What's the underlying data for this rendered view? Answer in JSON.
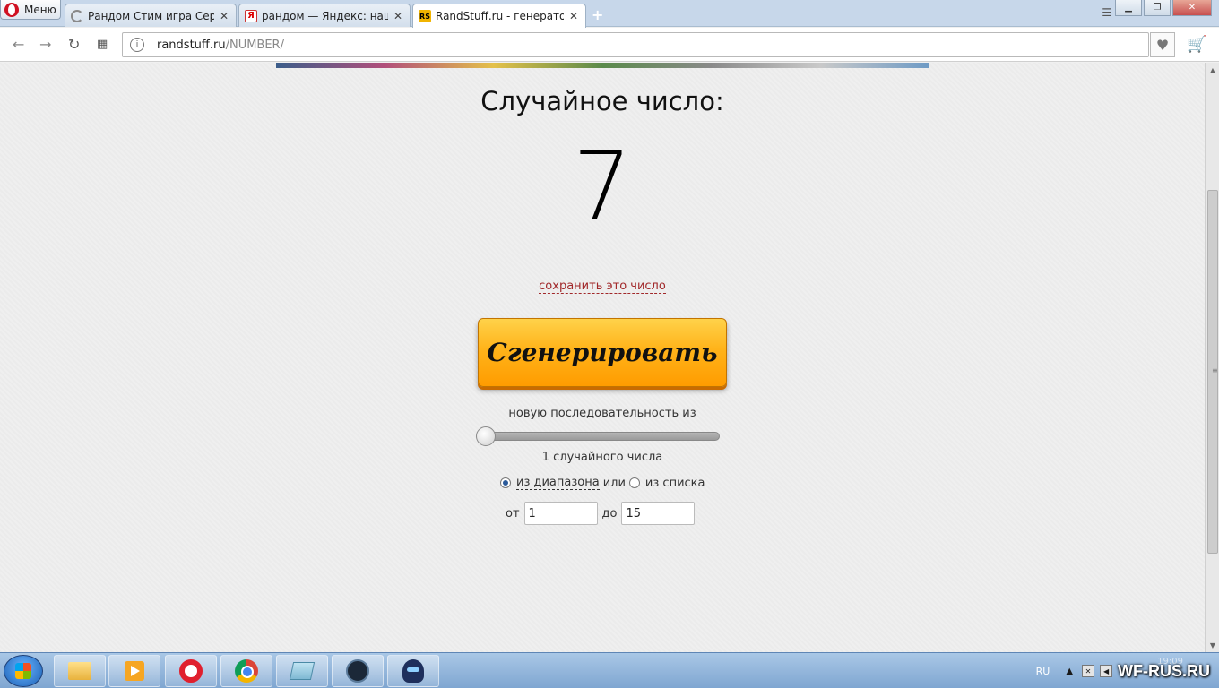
{
  "browser": {
    "menu_label": "Меню",
    "tabs": [
      {
        "title": "Рандом Стим игра Серьё",
        "favicon": "loading-icon"
      },
      {
        "title": "рандом — Яндекс: нашло",
        "favicon": "yandex-icon",
        "favicon_text": "Я"
      },
      {
        "title": "RandStuff.ru - генератор с",
        "favicon": "randstuff-icon",
        "favicon_text": "RS",
        "active": true
      }
    ],
    "url_host": "randstuff.ru",
    "url_path": "/NUMBER/"
  },
  "page": {
    "heading": "Случайное число:",
    "number": "7",
    "save_link": "сохранить это число",
    "generate_label": "Сгенерировать",
    "sequence_label": "новую последовательность из",
    "slider": {
      "value": 1,
      "position_fraction": 0.0
    },
    "count_label": "1 случайного числа",
    "mode": {
      "range_label": "из диапазона",
      "or_label": "или",
      "list_label": "из списка",
      "selected": "range"
    },
    "range": {
      "from_label": "от",
      "from_value": "1",
      "to_label": "до",
      "to_value": "15"
    }
  },
  "taskbar": {
    "lang": "RU",
    "watermark": "WF-RUS.RU",
    "clock": "19:09"
  },
  "colors": {
    "accent_button": "#ffb31a",
    "link": "#a1282a"
  }
}
